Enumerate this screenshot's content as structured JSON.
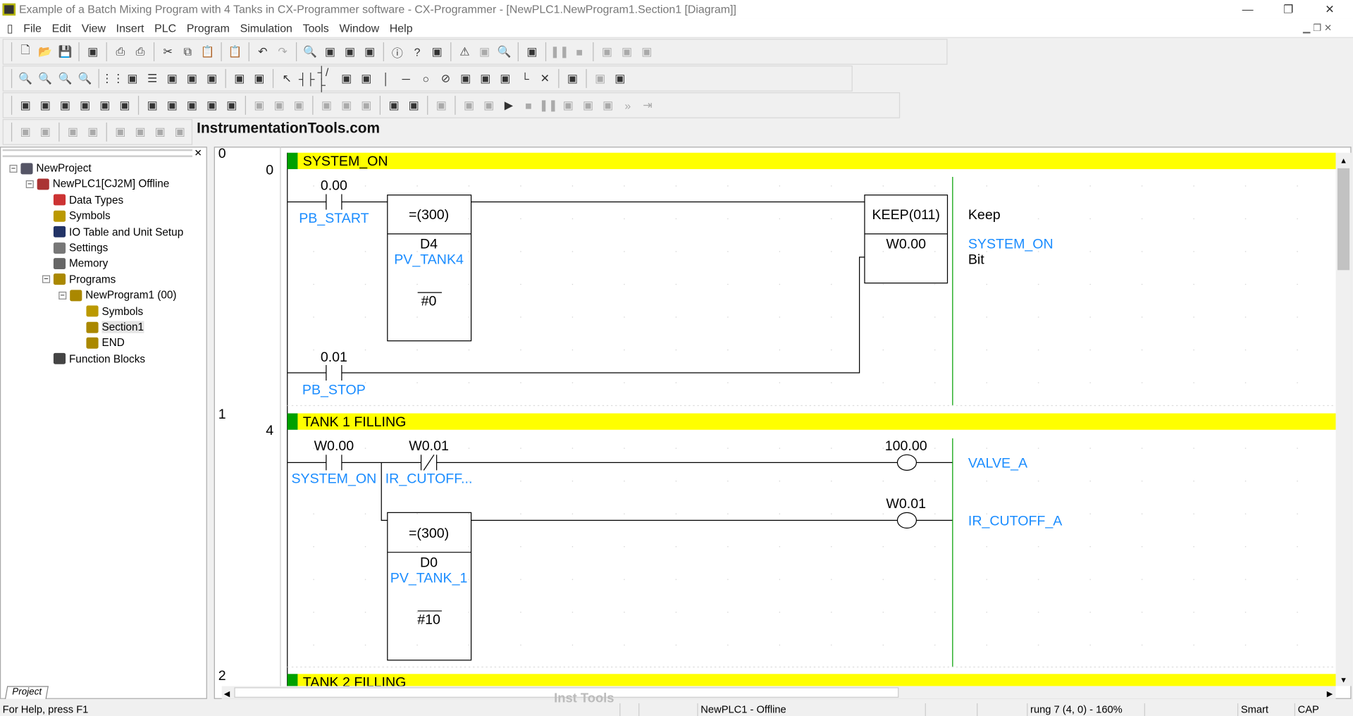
{
  "window": {
    "title": "Example of a Batch Mixing Program with 4 Tanks in CX-Programmer software - CX-Programmer - [NewPLC1.NewProgram1.Section1 [Diagram]]",
    "minimize": "—",
    "restore": "❐",
    "close": "✕"
  },
  "menu": [
    "File",
    "Edit",
    "View",
    "Insert",
    "PLC",
    "Program",
    "Simulation",
    "Tools",
    "Window",
    "Help"
  ],
  "toolbars": [
    [
      "new-icon",
      "open-icon",
      "save-icon",
      "|",
      "preview-icon",
      "|",
      "print-icon",
      "print-preview-icon",
      "|",
      "cut-icon",
      "copy-icon",
      "paste-icon",
      "|",
      "paste-special-icon",
      "|",
      "undo-icon",
      "redo-icon",
      "|",
      "find-icon",
      "replace-icon",
      "address-icon",
      "cross-ref-icon",
      "|",
      "about-icon",
      "help-icon",
      "context-help-icon",
      "|",
      "warning-icon",
      "compile-icon",
      "find-warning-icon",
      "|",
      "plc-warning-icon",
      "|",
      "pause-icon",
      "stop-icon",
      "|",
      "transfer-icon",
      "upload-icon",
      "compare-icon"
    ],
    [
      "zoom-in-icon",
      "zoom-fit-icon",
      "zoom-icon",
      "zoom-out-icon",
      "|",
      "grid-icon",
      "comment-icon",
      "list-icon",
      "ladder-icon",
      "symbol-table-icon",
      "tree-icon",
      "|",
      "sma-icon",
      "ci-icon",
      "|",
      "select-icon",
      "contact-no-icon",
      "contact-nc-icon",
      "or-contact-icon",
      "or-nc-icon",
      "vertical-icon",
      "horizontal-icon",
      "coil-icon",
      "coil-nc-icon",
      "instruction-icon",
      "block-icon",
      "branch-icon",
      "corner-icon",
      "delete-icon",
      "|",
      "online-edit-icon",
      "|",
      "transfer-icon",
      "io-table-icon"
    ],
    [
      "project-window-icon",
      "output-icon",
      "watch-icon",
      "address-ref-icon",
      "properties-icon",
      "edit-icon",
      "|",
      "function-block-icon",
      "symbols-icon",
      "ladder-view-icon",
      "mnemonic-icon",
      "data-icon",
      "|",
      "decimal-icon",
      "signed-icon",
      "hex-icon",
      "|",
      "up-icon",
      "down-icon",
      "force-icon",
      "|",
      "simulator-icon",
      "sim-connect-icon",
      "|",
      "sim-task-icon",
      "|",
      "hand-icon",
      "step-icon",
      "run-icon",
      "stop-icon",
      "pause-icon",
      "step-in-icon",
      "step-out-icon",
      "continuous-step-icon",
      "fast-forward-icon",
      "end-icon"
    ],
    [
      "indent-icon",
      "outdent-icon",
      "|",
      "lines-icon",
      "lines2-icon",
      "|",
      "trace-icon",
      "trace2-icon",
      "trace3-icon",
      "trace4-icon"
    ]
  ],
  "brand": "InstrumentationTools.com",
  "project_tab": "Project",
  "tree": [
    {
      "label": "NewProject",
      "level": 0,
      "icon": "project-icon",
      "expand": "−"
    },
    {
      "label": "NewPLC1[CJ2M] Offline",
      "level": 1,
      "icon": "plc-icon",
      "expand": "−"
    },
    {
      "label": "Data Types",
      "level": 2,
      "icon": "data-types-icon"
    },
    {
      "label": "Symbols",
      "level": 2,
      "icon": "symbols-icon"
    },
    {
      "label": "IO Table and Unit Setup",
      "level": 2,
      "icon": "io-table-icon"
    },
    {
      "label": "Settings",
      "level": 2,
      "icon": "settings-icon"
    },
    {
      "label": "Memory",
      "level": 2,
      "icon": "memory-icon"
    },
    {
      "label": "Programs",
      "level": 2,
      "icon": "programs-icon",
      "expand": "−"
    },
    {
      "label": "NewProgram1 (00)",
      "level": 3,
      "icon": "program-icon",
      "expand": "−"
    },
    {
      "label": "Symbols",
      "level": 4,
      "icon": "symbols-icon"
    },
    {
      "label": "Section1",
      "level": 4,
      "icon": "section-icon",
      "selected": true
    },
    {
      "label": "END",
      "level": 4,
      "icon": "section-icon"
    },
    {
      "label": "Function Blocks",
      "level": 2,
      "icon": "function-blocks-icon"
    }
  ],
  "rungs": [
    {
      "index": "0",
      "step": "0",
      "comment": "SYSTEM_ON",
      "contact1": {
        "address": "0.00",
        "symbol": "PB_START"
      },
      "compare": {
        "instr": "=(300)",
        "op1": "D4",
        "op1_symbol": "PV_TANK4",
        "op2": "#0"
      },
      "keep": {
        "instr": "KEEP(011)",
        "operand": "W0.00",
        "desc": "Keep",
        "symbol": "SYSTEM_ON",
        "type": "Bit"
      },
      "contact2": {
        "address": "0.01",
        "symbol": "PB_STOP"
      }
    },
    {
      "index": "1",
      "step": "4",
      "comment": "TANK 1 FILLING",
      "contact1": {
        "address": "W0.00",
        "symbol": "SYSTEM_ON"
      },
      "contact2": {
        "address": "W0.01",
        "symbol": "IR_CUTOFF..."
      },
      "coil1": {
        "address": "100.00",
        "symbol": "VALVE_A"
      },
      "compare": {
        "instr": "=(300)",
        "op1": "D0",
        "op1_symbol": "PV_TANK_1",
        "op2": "#10"
      },
      "coil2": {
        "address": "W0.01",
        "symbol": "IR_CUTOFF_A"
      }
    },
    {
      "index": "2",
      "comment": "TANK 2 FILLING"
    }
  ],
  "colors": {
    "comment_bar": "#ffff00",
    "rung_marker": "#00a000",
    "symbol": "#1a8cff",
    "right_rail": "#00a000"
  },
  "watermark": "Inst Tools",
  "status": {
    "help": "For Help, press F1",
    "plc": "NewPLC1 - Offline",
    "position": "rung 7 (4, 0) - 160%",
    "mode": "Smart",
    "caps": "CAP"
  }
}
